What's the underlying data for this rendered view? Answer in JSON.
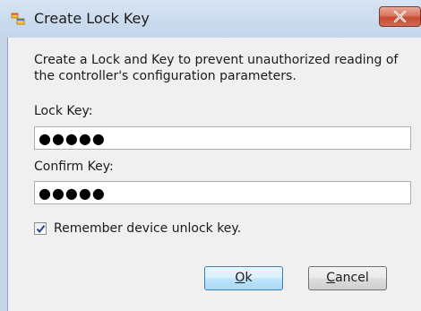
{
  "window": {
    "title": "Create Lock Key",
    "title_icon": "application-window-icon",
    "close_icon": "close-icon"
  },
  "dialog": {
    "description": "Create a Lock and Key to prevent unauthorized reading of the controller's configuration parameters.",
    "lock_key": {
      "label": "Lock Key:",
      "value": "●●●●●"
    },
    "confirm_key": {
      "label": "Confirm Key:",
      "value": "●●●●●"
    },
    "remember": {
      "label": "Remember device unlock key.",
      "checked": true
    },
    "buttons": {
      "ok": {
        "mnemonic": "O",
        "rest": "k"
      },
      "cancel": {
        "mnemonic": "C",
        "rest": "ancel"
      }
    }
  },
  "colors": {
    "title_bar": "#c3d5ea",
    "client_bg": "#f0f0f0",
    "close_button": "#c64a30",
    "default_button_border": "#3c7fb1"
  }
}
